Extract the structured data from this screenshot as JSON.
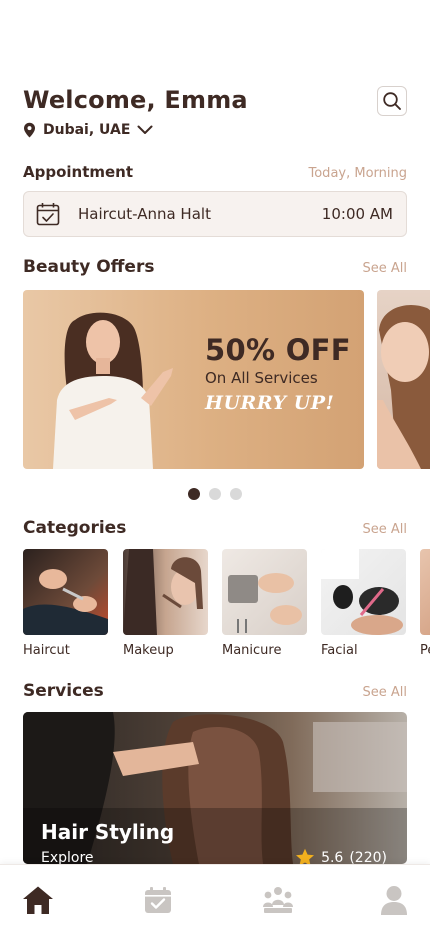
{
  "header": {
    "welcome": "Welcome, Emma",
    "location": "Dubai, UAE",
    "search_icon": "search-icon"
  },
  "appointment": {
    "title": "Appointment",
    "when": "Today, Morning",
    "service": "Haircut-Anna Halt",
    "time": "10:00 AM"
  },
  "offers": {
    "title": "Beauty Offers",
    "see_all": "See All",
    "banner": {
      "headline": "50% OFF",
      "subline": "On All Services",
      "tagline": "HURRY UP!"
    },
    "active_page": 1,
    "total_pages": 3
  },
  "categories": {
    "title": "Categories",
    "see_all": "See All",
    "items": [
      {
        "label": "Haircut"
      },
      {
        "label": "Makeup"
      },
      {
        "label": "Manicure"
      },
      {
        "label": "Facial"
      },
      {
        "label": "Pe"
      }
    ]
  },
  "services": {
    "title": "Services",
    "see_all": "See All",
    "card": {
      "title": "Hair Styling",
      "subtitle": "Explore",
      "rating": "5.6",
      "reviews": "(220)"
    }
  },
  "tabbar": {
    "items": [
      "home-icon",
      "calendar-icon",
      "team-icon",
      "profile-icon"
    ],
    "active": "home-icon"
  },
  "colors": {
    "primary": "#3e2a24",
    "accent": "#c9a48f",
    "inactive_icon": "#c9c5c2",
    "star": "#f2b01e"
  }
}
